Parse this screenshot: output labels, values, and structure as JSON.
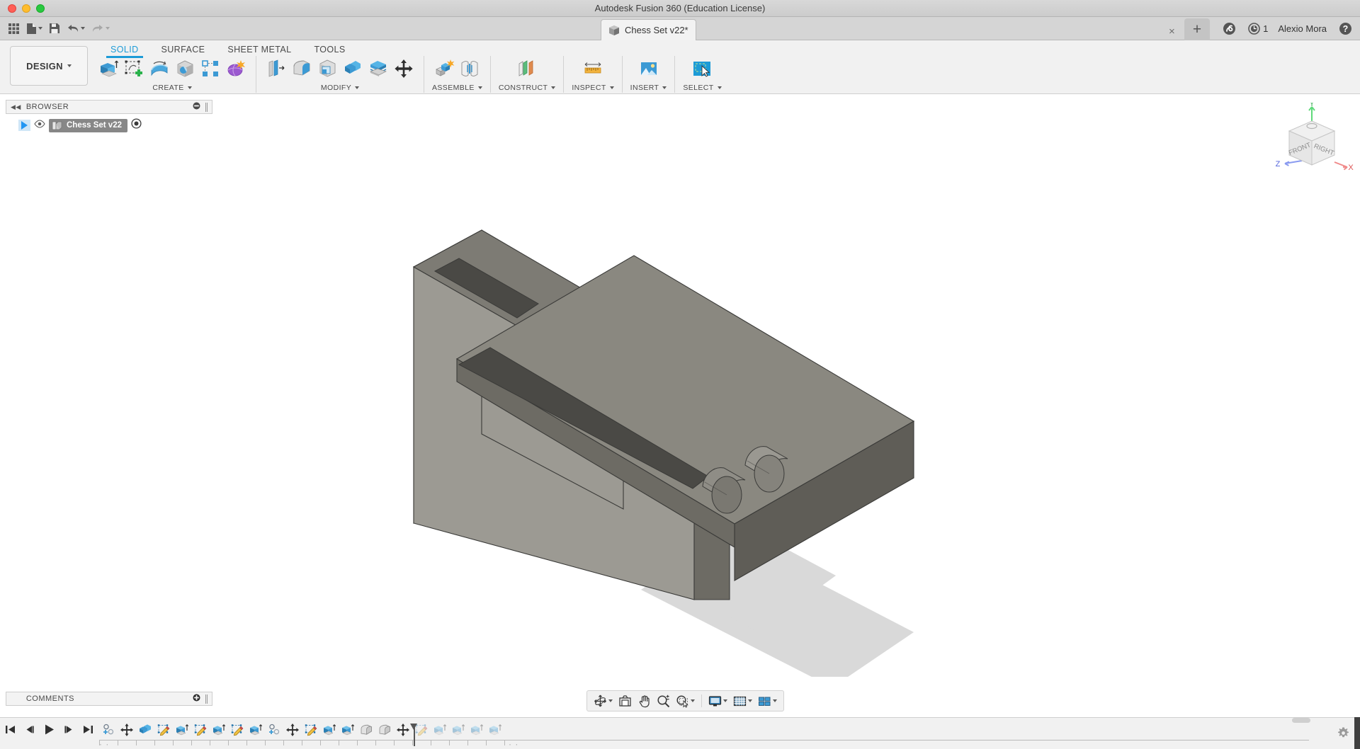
{
  "window": {
    "app_title": "Autodesk Fusion 360 (Education License)",
    "traffic_lights": [
      "close-red",
      "minimize-yellow",
      "maximize-green"
    ]
  },
  "quick_access": {
    "buttons": [
      {
        "name": "app-grid-icon",
        "label": "Show Data Panel"
      },
      {
        "name": "file-icon",
        "label": "File"
      },
      {
        "name": "save-icon",
        "label": "Save"
      },
      {
        "name": "undo-icon",
        "label": "Undo"
      },
      {
        "name": "redo-icon",
        "label": "Redo"
      }
    ]
  },
  "document_tab": {
    "title": "Chess Set v22*",
    "icon": "cube-icon",
    "close_label": "×",
    "new_tab_label": "+"
  },
  "account_bar": {
    "extension_icon": "fusion-extension-icon",
    "job_status_icon": "job-status-clock-icon",
    "job_count": "1",
    "user_name": "Alexio Mora",
    "help_icon": "help-question-icon"
  },
  "ribbon": {
    "workspace_button": {
      "label": "DESIGN",
      "caret": "▾"
    },
    "tabs": [
      {
        "label": "SOLID",
        "active": true
      },
      {
        "label": "SURFACE",
        "active": false
      },
      {
        "label": "SHEET METAL",
        "active": false
      },
      {
        "label": "TOOLS",
        "active": false
      }
    ],
    "panels": [
      {
        "label": "CREATE",
        "has_caret": true,
        "tools": [
          {
            "name": "extrude-icon",
            "label": "Extrude"
          },
          {
            "name": "create-sketch-icon",
            "label": "Create Sketch"
          },
          {
            "name": "revolve-icon",
            "label": "Revolve"
          },
          {
            "name": "sweep-icon",
            "label": "Sweep"
          },
          {
            "name": "pattern-icon",
            "label": "Pattern"
          },
          {
            "name": "create-form-icon",
            "label": "Create Form"
          }
        ]
      },
      {
        "label": "MODIFY",
        "has_caret": true,
        "tools": [
          {
            "name": "press-pull-icon",
            "label": "Press Pull"
          },
          {
            "name": "fillet-icon",
            "label": "Fillet"
          },
          {
            "name": "shell-icon",
            "label": "Shell"
          },
          {
            "name": "combine-icon",
            "label": "Combine"
          },
          {
            "name": "split-face-icon",
            "label": "Split Face"
          },
          {
            "name": "move-copy-icon",
            "label": "Move/Copy"
          }
        ]
      },
      {
        "label": "ASSEMBLE",
        "has_caret": true,
        "tools": [
          {
            "name": "new-component-icon",
            "label": "New Component"
          },
          {
            "name": "joint-icon",
            "label": "Joint"
          }
        ]
      },
      {
        "label": "CONSTRUCT",
        "has_caret": true,
        "tools": [
          {
            "name": "offset-plane-icon",
            "label": "Offset Plane"
          }
        ]
      },
      {
        "label": "INSPECT",
        "has_caret": true,
        "tools": [
          {
            "name": "measure-icon",
            "label": "Measure"
          }
        ]
      },
      {
        "label": "INSERT",
        "has_caret": true,
        "tools": [
          {
            "name": "insert-image-icon",
            "label": "Decal"
          }
        ]
      },
      {
        "label": "SELECT",
        "has_caret": true,
        "tools": [
          {
            "name": "select-window-icon",
            "label": "Select"
          }
        ]
      }
    ]
  },
  "browser": {
    "header": "BROWSER",
    "collapse_icon": "collapse-left-icon",
    "minimize_icon": "minimize-dot-icon",
    "root": {
      "name": "Chess Set v22",
      "expand_icon": "expand-triangle-icon",
      "visibility_icon": "eye-icon",
      "document_icon": "document-component-icon",
      "activate_icon": "activate-radio-icon"
    }
  },
  "comments": {
    "header": "COMMENTS",
    "add_icon": "add-comment-icon"
  },
  "viewcube": {
    "face_front": "FRONT",
    "face_right": "RIGHT",
    "axis_x": "X",
    "axis_y": "Y",
    "axis_z": "Z",
    "home_icon": "home-icon"
  },
  "navbar": {
    "buttons": [
      {
        "name": "orbit-icon",
        "label": "Orbit",
        "caret": true
      },
      {
        "name": "look-at-icon",
        "label": "Look At",
        "caret": false
      },
      {
        "name": "pan-icon",
        "label": "Pan",
        "caret": false
      },
      {
        "name": "zoom-icon",
        "label": "Zoom",
        "caret": false
      },
      {
        "name": "zoom-window-icon",
        "label": "Zoom Window",
        "caret": true
      },
      {
        "name": "display-settings-icon",
        "label": "Display Settings",
        "caret": true
      },
      {
        "name": "grid-snap-icon",
        "label": "Grid and Snaps",
        "caret": true
      },
      {
        "name": "viewports-icon",
        "label": "Viewports",
        "caret": true
      }
    ]
  },
  "timeline": {
    "playback": [
      {
        "name": "jump-start-icon",
        "label": "Go to beginning"
      },
      {
        "name": "step-back-icon",
        "label": "Step back"
      },
      {
        "name": "play-icon",
        "label": "Play"
      },
      {
        "name": "step-forward-icon",
        "label": "Step forward"
      },
      {
        "name": "jump-end-icon",
        "label": "Go to end"
      }
    ],
    "features": [
      {
        "name": "timeline-feature-new-component",
        "type": "new-component",
        "faded": false
      },
      {
        "name": "timeline-feature-move",
        "type": "move",
        "faded": false
      },
      {
        "name": "timeline-feature-combine",
        "type": "combine",
        "faded": false
      },
      {
        "name": "timeline-feature-sketch",
        "type": "sketch",
        "faded": false
      },
      {
        "name": "timeline-feature-extrude",
        "type": "extrude",
        "faded": false
      },
      {
        "name": "timeline-feature-sketch",
        "type": "sketch",
        "faded": false
      },
      {
        "name": "timeline-feature-extrude",
        "type": "extrude",
        "faded": false
      },
      {
        "name": "timeline-feature-sketch",
        "type": "sketch",
        "faded": false
      },
      {
        "name": "timeline-feature-extrude",
        "type": "extrude",
        "faded": false
      },
      {
        "name": "timeline-feature-new-component",
        "type": "new-component",
        "faded": false
      },
      {
        "name": "timeline-feature-move",
        "type": "move",
        "faded": false
      },
      {
        "name": "timeline-feature-sketch",
        "type": "sketch",
        "faded": false
      },
      {
        "name": "timeline-feature-extrude",
        "type": "extrude",
        "faded": false
      },
      {
        "name": "timeline-feature-extrude",
        "type": "extrude",
        "faded": false
      },
      {
        "name": "timeline-feature-fillet",
        "type": "fillet",
        "faded": false
      },
      {
        "name": "timeline-feature-fillet",
        "type": "fillet",
        "faded": false
      },
      {
        "name": "timeline-feature-move",
        "type": "move",
        "faded": false
      },
      {
        "name": "timeline-feature-sketch",
        "type": "sketch",
        "faded": true
      },
      {
        "name": "timeline-feature-extrude",
        "type": "extrude",
        "faded": true
      },
      {
        "name": "timeline-feature-extrude",
        "type": "extrude",
        "faded": true
      },
      {
        "name": "timeline-feature-extrude",
        "type": "extrude",
        "faded": true
      },
      {
        "name": "timeline-feature-extrude",
        "type": "extrude",
        "faded": true
      }
    ],
    "marker_position_index": 17,
    "settings_icon": "timeline-settings-gear-icon",
    "leading_ellipsis": "· ·",
    "trailing_ellipsis": "· ·"
  },
  "colors": {
    "accent_blue": "#1d9bd7",
    "chrome_gray": "#f1f1f1",
    "titlebar_gray": "#d5d5d5",
    "canvas_white": "#ffffff",
    "model_top": "#8a8880",
    "model_front": "#9a9891",
    "model_side": "#6f6d66",
    "shadow": "#d8d8d8"
  },
  "model": {
    "name": "chess-set-joint-model",
    "description": "Grey shaded solid body with two cylindrical pins"
  }
}
